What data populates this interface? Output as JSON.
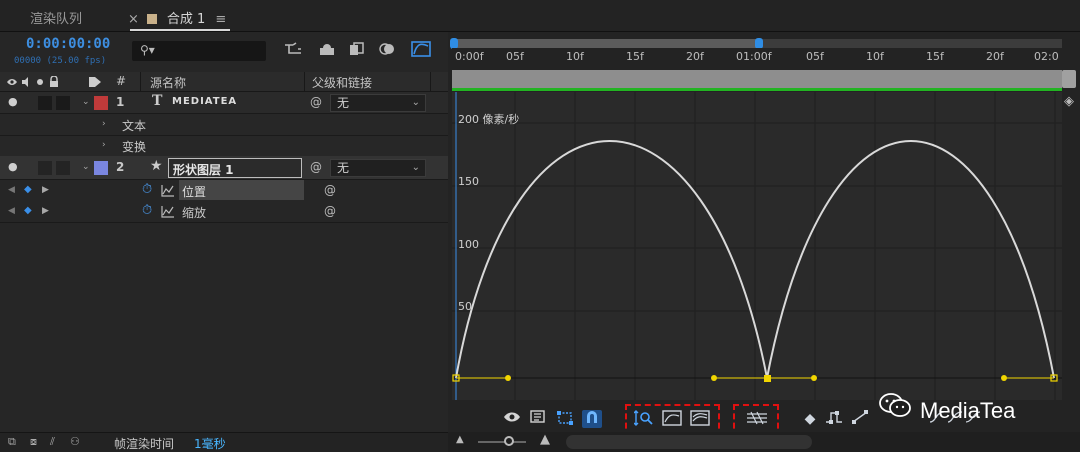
{
  "tabs": {
    "render_queue": "渲染队列",
    "composition": "合成 1",
    "close_glyph": "×",
    "menu_glyph": "≡"
  },
  "timeline": {
    "timecode": "0:00:00:00",
    "fps": "00000 (25.00 fps)",
    "search_icon": "⚲▾",
    "columns": {
      "hash": "#",
      "source_name": "源名称",
      "parent_link": "父级和链接"
    },
    "layers": [
      {
        "number": "1",
        "type_glyph": "T",
        "name": "MEDIATEA",
        "color": "#c03a3a",
        "parent": "无"
      },
      {
        "number": "2",
        "type_glyph": "★",
        "name": "形状图层 1",
        "color": "#7a86e0",
        "parent": "无"
      }
    ],
    "subgroups": [
      "文本",
      "变换"
    ],
    "properties": [
      "位置",
      "缩放"
    ],
    "footer_label": "帧渲染时间",
    "footer_value": "1毫秒"
  },
  "ruler": {
    "ticks": [
      "0:00f",
      "05f",
      "10f",
      "15f",
      "20f",
      "01:00f",
      "05f",
      "10f",
      "15f",
      "20f",
      "02:0"
    ]
  },
  "graph": {
    "y_unit_label": "200 像素/秒",
    "y_ticks": [
      "150",
      "100",
      "50"
    ],
    "peak_value": 207,
    "colors": {
      "curve": "#d9d9d9",
      "keyframe": "#f2d600",
      "playhead": "#3a8fe8",
      "highlight": "#e01010"
    }
  },
  "watermark": "MediaTea"
}
